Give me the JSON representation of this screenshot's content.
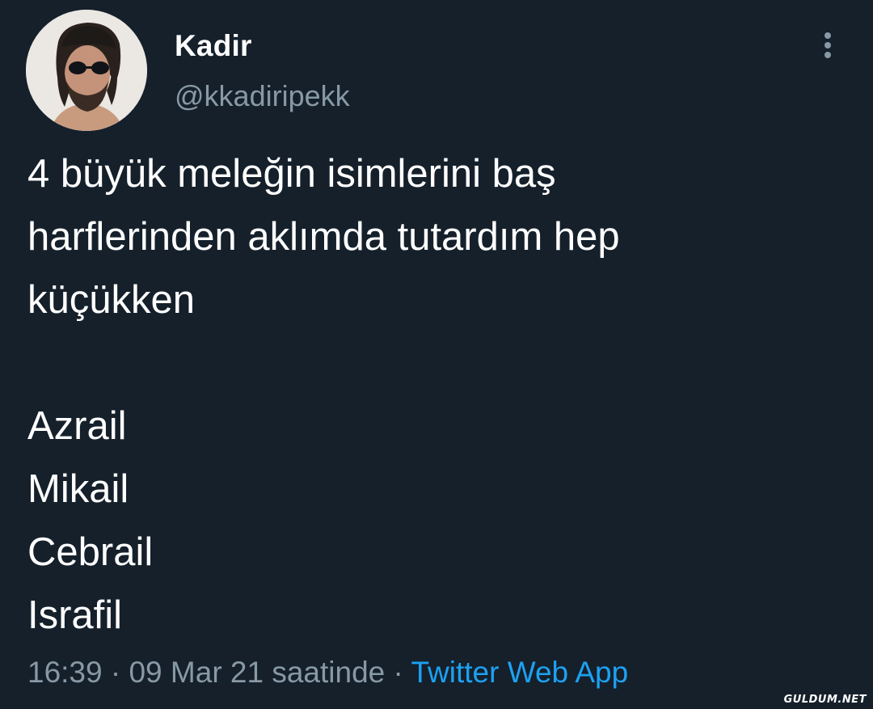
{
  "author": {
    "display_name": "Kadir",
    "handle": "@kkadiripekk"
  },
  "tweet": {
    "intro_lines": [
      "4 büyük meleğin isimlerini baş",
      "harflerinden aklımda tutardım hep",
      "küçükken"
    ],
    "list_lines": [
      "Azrail",
      "Mikail",
      "Cebrail",
      "Israfil"
    ]
  },
  "meta": {
    "time": "16:39",
    "separator": "·",
    "date": "09 Mar 21 saatinde",
    "source": "Twitter Web App"
  },
  "icons": {
    "more": "more-vertical-icon"
  },
  "watermark": "GULDUM.NET",
  "colors": {
    "background": "#15202b",
    "text": "#ffffff",
    "muted": "#8899a6",
    "link": "#1da1f2"
  }
}
